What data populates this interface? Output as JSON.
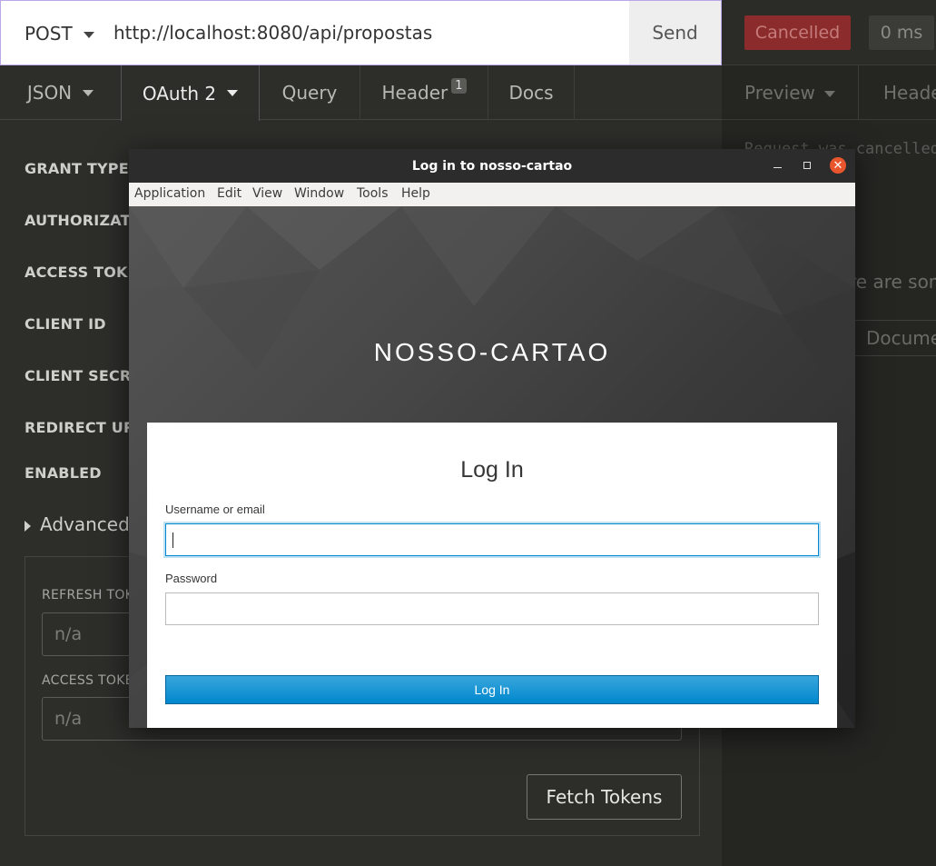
{
  "request": {
    "method": "POST",
    "url": "http://localhost:8080/api/propostas",
    "send_label": "Send"
  },
  "request_tabs": [
    {
      "label": "JSON",
      "dropdown": true
    },
    {
      "label": "OAuth 2",
      "dropdown": true,
      "active": true
    },
    {
      "label": "Query"
    },
    {
      "label": "Header",
      "count": "1"
    },
    {
      "label": "Docs"
    }
  ],
  "oauth": {
    "fields": [
      "GRANT TYPE",
      "AUTHORIZATIO",
      "ACCESS TOKEN",
      "CLIENT ID",
      "CLIENT SECRET",
      "REDIRECT URL (",
      "ENABLED"
    ],
    "advanced_label": "Advanced (",
    "refresh_label": "REFRESH TOK",
    "refresh_value": "n/a",
    "access_label": "ACCESS TOKE",
    "access_value": "n/a",
    "fetch_label": "Fetch Tokens"
  },
  "response": {
    "status": "Cancelled",
    "time": "0 ms",
    "tabs": [
      "Preview",
      "Heade"
    ],
    "message": "Request was cancelled",
    "some_text": "re are som",
    "docs_label": "Docume"
  },
  "login_window": {
    "title": "Log in to nosso-cartao",
    "menu": [
      "Application",
      "Edit",
      "View",
      "Window",
      "Tools",
      "Help"
    ],
    "realm": "NOSSO-CARTAO",
    "heading": "Log In",
    "username_label": "Username or email",
    "username_value": "",
    "password_label": "Password",
    "password_value": "",
    "login_button": "Log In"
  },
  "colors": {
    "accent_blue": "#0088ce",
    "cancel_red": "#8b2b2b",
    "close_orange": "#e9552d"
  }
}
